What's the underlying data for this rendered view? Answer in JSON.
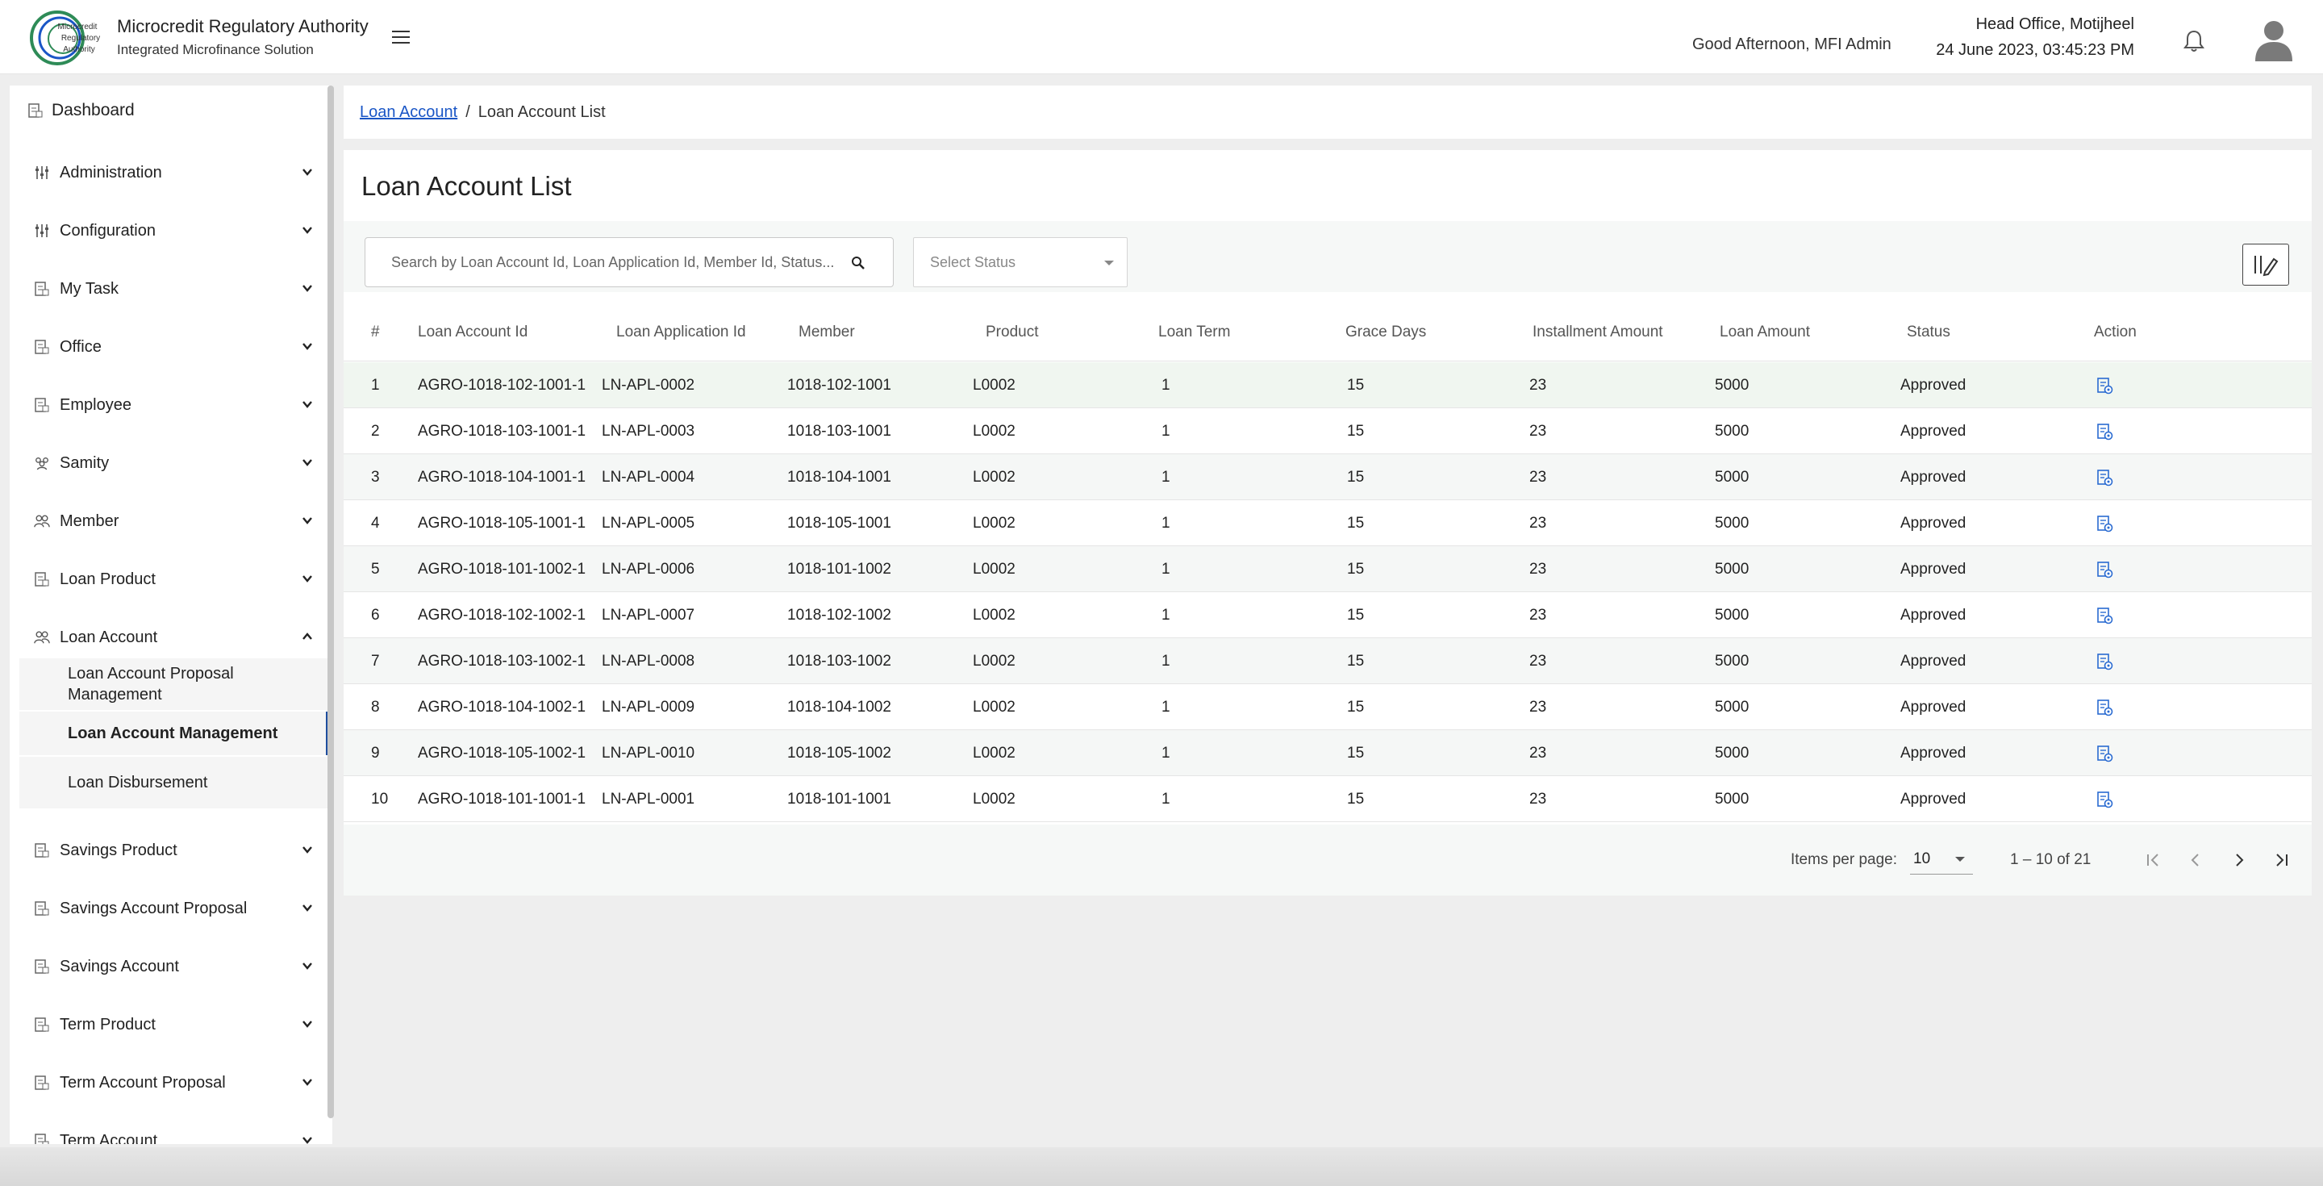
{
  "header": {
    "org_title": "Microcredit Regulatory Authority",
    "org_subtitle": "Integrated Microfinance Solution",
    "logo_text": "Microcredit Regulatory Authority",
    "greeting": "Good Afternoon, MFI Admin",
    "office": "Head Office, Motijheel",
    "datetime": "24 June 2023, 03:45:23 PM"
  },
  "sidebar": {
    "dashboard": "Dashboard",
    "groups": [
      {
        "label": "Administration",
        "icon": "sliders-icon"
      },
      {
        "label": "Configuration",
        "icon": "sliders-icon"
      },
      {
        "label": "My Task",
        "icon": "document-icon"
      },
      {
        "label": "Office",
        "icon": "document-icon"
      },
      {
        "label": "Employee",
        "icon": "document-icon"
      },
      {
        "label": "Samity",
        "icon": "group-icon"
      },
      {
        "label": "Member",
        "icon": "people-icon"
      },
      {
        "label": "Loan Product",
        "icon": "document-icon"
      },
      {
        "label": "Loan Account",
        "icon": "people-icon"
      },
      {
        "label": "Savings Product",
        "icon": "document-icon"
      },
      {
        "label": "Savings Account Proposal",
        "icon": "document-icon"
      },
      {
        "label": "Savings Account",
        "icon": "document-icon"
      },
      {
        "label": "Term Product",
        "icon": "document-icon"
      },
      {
        "label": "Term Account Proposal",
        "icon": "document-icon"
      },
      {
        "label": "Term Account",
        "icon": "document-icon"
      }
    ],
    "loan_account_children": [
      "Loan Account Proposal Management",
      "Loan Account Management",
      "Loan Disbursement"
    ]
  },
  "breadcrumb": {
    "parent": "Loan Account",
    "separator": "/",
    "current": "Loan Account List"
  },
  "page": {
    "title": "Loan Account List",
    "search_placeholder": "Search by Loan Account Id, Loan Application Id, Member Id, Status...",
    "status_placeholder": "Select Status"
  },
  "table": {
    "headers": [
      "#",
      "Loan Account Id",
      "Loan Application Id",
      "Member",
      "Product",
      "Loan Term",
      "Grace Days",
      "Installment Amount",
      "Loan Amount",
      "Status",
      "Action"
    ],
    "rows": [
      [
        "1",
        "AGRO-1018-102-1001-1",
        "LN-APL-0002",
        "1018-102-1001",
        "L0002",
        "1",
        "15",
        "23",
        "5000",
        "Approved"
      ],
      [
        "2",
        "AGRO-1018-103-1001-1",
        "LN-APL-0003",
        "1018-103-1001",
        "L0002",
        "1",
        "15",
        "23",
        "5000",
        "Approved"
      ],
      [
        "3",
        "AGRO-1018-104-1001-1",
        "LN-APL-0004",
        "1018-104-1001",
        "L0002",
        "1",
        "15",
        "23",
        "5000",
        "Approved"
      ],
      [
        "4",
        "AGRO-1018-105-1001-1",
        "LN-APL-0005",
        "1018-105-1001",
        "L0002",
        "1",
        "15",
        "23",
        "5000",
        "Approved"
      ],
      [
        "5",
        "AGRO-1018-101-1002-1",
        "LN-APL-0006",
        "1018-101-1002",
        "L0002",
        "1",
        "15",
        "23",
        "5000",
        "Approved"
      ],
      [
        "6",
        "AGRO-1018-102-1002-1",
        "LN-APL-0007",
        "1018-102-1002",
        "L0002",
        "1",
        "15",
        "23",
        "5000",
        "Approved"
      ],
      [
        "7",
        "AGRO-1018-103-1002-1",
        "LN-APL-0008",
        "1018-103-1002",
        "L0002",
        "1",
        "15",
        "23",
        "5000",
        "Approved"
      ],
      [
        "8",
        "AGRO-1018-104-1002-1",
        "LN-APL-0009",
        "1018-104-1002",
        "L0002",
        "1",
        "15",
        "23",
        "5000",
        "Approved"
      ],
      [
        "9",
        "AGRO-1018-105-1002-1",
        "LN-APL-0010",
        "1018-105-1002",
        "L0002",
        "1",
        "15",
        "23",
        "5000",
        "Approved"
      ],
      [
        "10",
        "AGRO-1018-101-1001-1",
        "LN-APL-0001",
        "1018-101-1001",
        "L0002",
        "1",
        "15",
        "23",
        "5000",
        "Approved"
      ]
    ]
  },
  "paginator": {
    "items_per_page_label": "Items per page:",
    "page_size": "10",
    "range": "1 – 10 of 21"
  },
  "colors": {
    "accent": "#1a56c6",
    "active_indicator": "#1f4e9e",
    "action_icon": "#2a6bd1"
  }
}
